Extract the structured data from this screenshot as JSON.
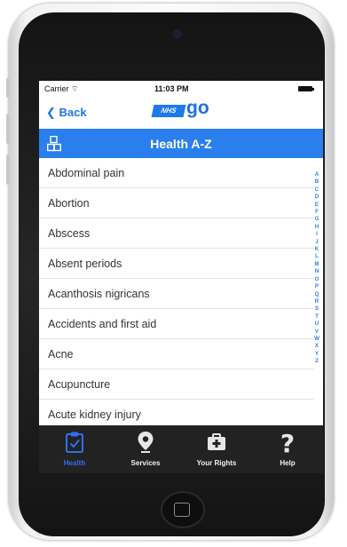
{
  "status_bar": {
    "carrier": "Carrier",
    "time": "11:03 PM"
  },
  "nav": {
    "back_label": "Back",
    "logo_nhs": "NHS",
    "logo_go": "go"
  },
  "header": {
    "title": "Health A-Z"
  },
  "list": {
    "items": [
      "Abdominal pain",
      "Abortion",
      "Abscess",
      "Absent periods",
      "Acanthosis nigricans",
      "Accidents and first aid",
      "Acne",
      "Acupuncture",
      "Acute kidney injury"
    ]
  },
  "index": {
    "letters": [
      "A",
      "B",
      "C",
      "D",
      "E",
      "F",
      "G",
      "H",
      "I",
      "J",
      "K",
      "L",
      "M",
      "N",
      "O",
      "P",
      "Q",
      "R",
      "S",
      "T",
      "U",
      "V",
      "W",
      "X",
      "Y",
      "Z"
    ]
  },
  "tabs": {
    "health": "Health",
    "services": "Services",
    "rights": "Your Rights",
    "help": "Help"
  },
  "colors": {
    "accent": "#2b7fec",
    "tab_active": "#2f6ff0",
    "tabbar_bg": "#222222"
  }
}
